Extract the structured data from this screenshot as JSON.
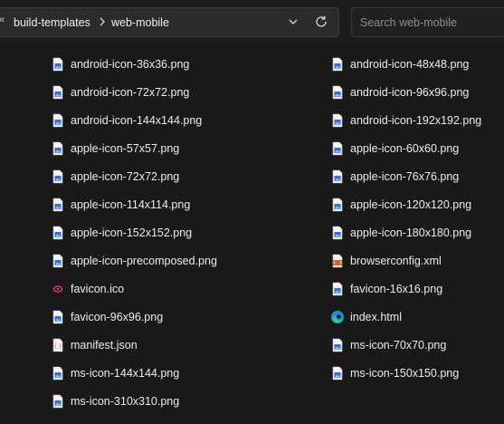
{
  "address": {
    "overflow_label": "«",
    "crumbs": [
      "build-templates",
      "web-mobile"
    ]
  },
  "search": {
    "placeholder": "Search web-mobile"
  },
  "files": [
    {
      "name": "android-icon-36x36.png",
      "icon": "png-image-icon"
    },
    {
      "name": "android-icon-48x48.png",
      "icon": "png-image-icon"
    },
    {
      "name": "android-icon-72x72.png",
      "icon": "png-image-icon"
    },
    {
      "name": "android-icon-96x96.png",
      "icon": "png-image-icon"
    },
    {
      "name": "android-icon-144x144.png",
      "icon": "png-image-icon"
    },
    {
      "name": "android-icon-192x192.png",
      "icon": "png-image-icon"
    },
    {
      "name": "apple-icon-57x57.png",
      "icon": "png-image-icon"
    },
    {
      "name": "apple-icon-60x60.png",
      "icon": "png-image-icon"
    },
    {
      "name": "apple-icon-72x72.png",
      "icon": "png-image-icon"
    },
    {
      "name": "apple-icon-76x76.png",
      "icon": "png-image-icon"
    },
    {
      "name": "apple-icon-114x114.png",
      "icon": "png-image-icon"
    },
    {
      "name": "apple-icon-120x120.png",
      "icon": "png-image-icon"
    },
    {
      "name": "apple-icon-152x152.png",
      "icon": "png-image-icon"
    },
    {
      "name": "apple-icon-180x180.png",
      "icon": "png-image-icon"
    },
    {
      "name": "apple-icon-precomposed.png",
      "icon": "png-image-icon"
    },
    {
      "name": "browserconfig.xml",
      "icon": "xml-file-icon"
    },
    {
      "name": "favicon.ico",
      "icon": "ico-file-icon"
    },
    {
      "name": "favicon-16x16.png",
      "icon": "png-image-icon"
    },
    {
      "name": "favicon-96x96.png",
      "icon": "png-image-icon"
    },
    {
      "name": "index.html",
      "icon": "edge-browser-icon"
    },
    {
      "name": "manifest.json",
      "icon": "json-file-icon"
    },
    {
      "name": "ms-icon-70x70.png",
      "icon": "png-image-icon"
    },
    {
      "name": "ms-icon-144x144.png",
      "icon": "png-image-icon"
    },
    {
      "name": "ms-icon-150x150.png",
      "icon": "png-image-icon"
    },
    {
      "name": "ms-icon-310x310.png",
      "icon": "png-image-icon"
    }
  ],
  "colors": {
    "background": "#191919",
    "text": "#ececec",
    "png_icon_accent": "#2f6fd6",
    "xml_icon_accent": "#d9622b",
    "json_icon_accent": "#e8c34a"
  }
}
